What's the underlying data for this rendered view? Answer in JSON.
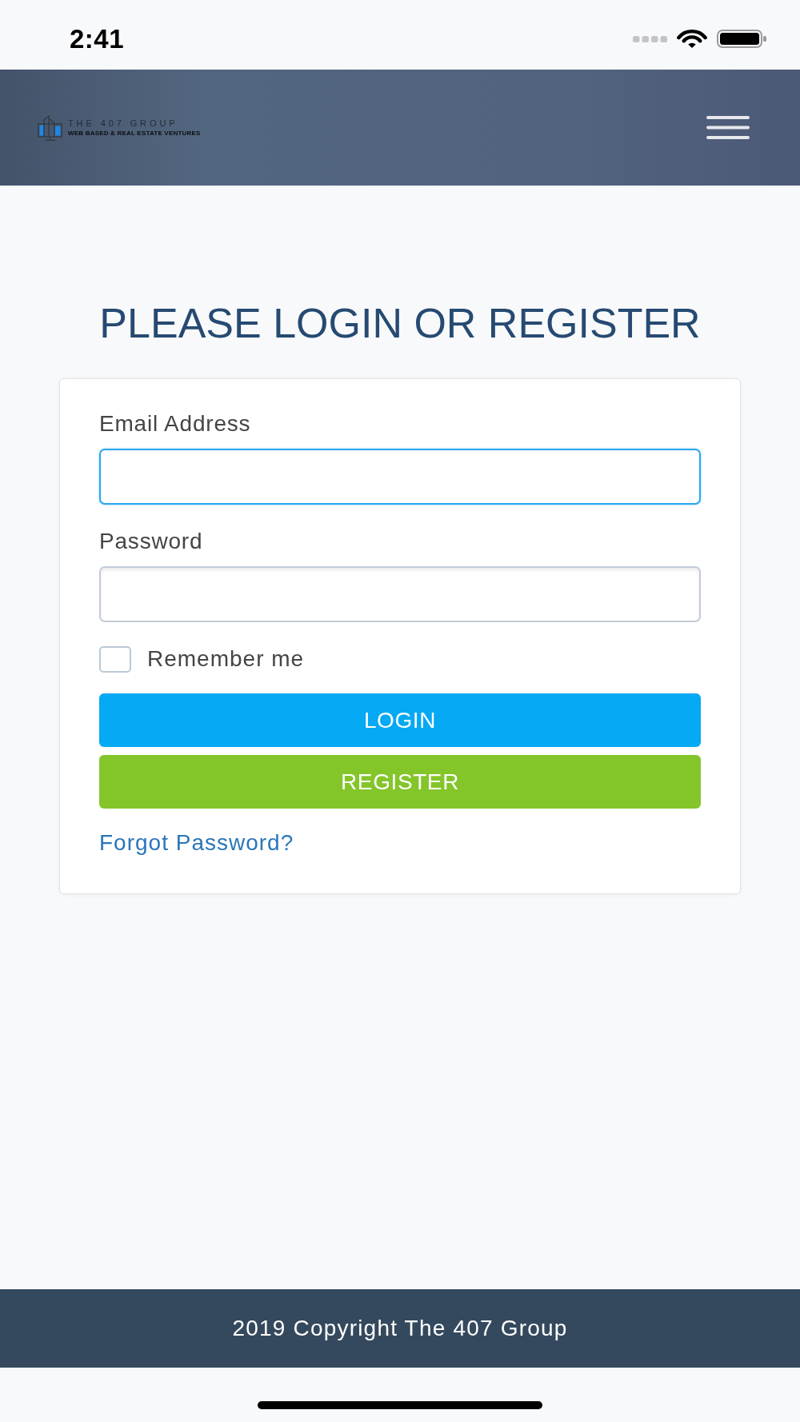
{
  "status_bar": {
    "time": "2:41"
  },
  "header": {
    "logo": {
      "name": "THE 407 GROUP",
      "tagline": "WEB BASED & REAL ESTATE VENTURES"
    }
  },
  "title": "PLEASE LOGIN OR REGISTER",
  "form": {
    "fields": [
      {
        "label": "Email Address",
        "focused": true
      },
      {
        "label": "Password",
        "focused": false
      }
    ],
    "remember": {
      "label": "Remember me",
      "checked": false
    },
    "buttons": [
      {
        "label": "LOGIN",
        "kind": "primary"
      },
      {
        "label": "REGISTER",
        "kind": "success"
      }
    ],
    "forgot_link": "Forgot Password?"
  },
  "footer": {
    "text": "2019 Copyright The 407 Group"
  }
}
